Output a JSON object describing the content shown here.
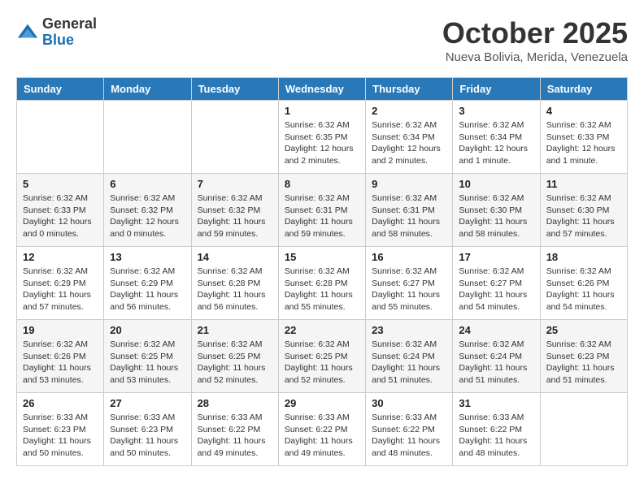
{
  "logo": {
    "general": "General",
    "blue": "Blue"
  },
  "title": "October 2025",
  "location": "Nueva Bolivia, Merida, Venezuela",
  "days_of_week": [
    "Sunday",
    "Monday",
    "Tuesday",
    "Wednesday",
    "Thursday",
    "Friday",
    "Saturday"
  ],
  "weeks": [
    [
      {
        "day": "",
        "info": ""
      },
      {
        "day": "",
        "info": ""
      },
      {
        "day": "",
        "info": ""
      },
      {
        "day": "1",
        "info": "Sunrise: 6:32 AM\nSunset: 6:35 PM\nDaylight: 12 hours and 2 minutes."
      },
      {
        "day": "2",
        "info": "Sunrise: 6:32 AM\nSunset: 6:34 PM\nDaylight: 12 hours and 2 minutes."
      },
      {
        "day": "3",
        "info": "Sunrise: 6:32 AM\nSunset: 6:34 PM\nDaylight: 12 hours and 1 minute."
      },
      {
        "day": "4",
        "info": "Sunrise: 6:32 AM\nSunset: 6:33 PM\nDaylight: 12 hours and 1 minute."
      }
    ],
    [
      {
        "day": "5",
        "info": "Sunrise: 6:32 AM\nSunset: 6:33 PM\nDaylight: 12 hours and 0 minutes."
      },
      {
        "day": "6",
        "info": "Sunrise: 6:32 AM\nSunset: 6:32 PM\nDaylight: 12 hours and 0 minutes."
      },
      {
        "day": "7",
        "info": "Sunrise: 6:32 AM\nSunset: 6:32 PM\nDaylight: 11 hours and 59 minutes."
      },
      {
        "day": "8",
        "info": "Sunrise: 6:32 AM\nSunset: 6:31 PM\nDaylight: 11 hours and 59 minutes."
      },
      {
        "day": "9",
        "info": "Sunrise: 6:32 AM\nSunset: 6:31 PM\nDaylight: 11 hours and 58 minutes."
      },
      {
        "day": "10",
        "info": "Sunrise: 6:32 AM\nSunset: 6:30 PM\nDaylight: 11 hours and 58 minutes."
      },
      {
        "day": "11",
        "info": "Sunrise: 6:32 AM\nSunset: 6:30 PM\nDaylight: 11 hours and 57 minutes."
      }
    ],
    [
      {
        "day": "12",
        "info": "Sunrise: 6:32 AM\nSunset: 6:29 PM\nDaylight: 11 hours and 57 minutes."
      },
      {
        "day": "13",
        "info": "Sunrise: 6:32 AM\nSunset: 6:29 PM\nDaylight: 11 hours and 56 minutes."
      },
      {
        "day": "14",
        "info": "Sunrise: 6:32 AM\nSunset: 6:28 PM\nDaylight: 11 hours and 56 minutes."
      },
      {
        "day": "15",
        "info": "Sunrise: 6:32 AM\nSunset: 6:28 PM\nDaylight: 11 hours and 55 minutes."
      },
      {
        "day": "16",
        "info": "Sunrise: 6:32 AM\nSunset: 6:27 PM\nDaylight: 11 hours and 55 minutes."
      },
      {
        "day": "17",
        "info": "Sunrise: 6:32 AM\nSunset: 6:27 PM\nDaylight: 11 hours and 54 minutes."
      },
      {
        "day": "18",
        "info": "Sunrise: 6:32 AM\nSunset: 6:26 PM\nDaylight: 11 hours and 54 minutes."
      }
    ],
    [
      {
        "day": "19",
        "info": "Sunrise: 6:32 AM\nSunset: 6:26 PM\nDaylight: 11 hours and 53 minutes."
      },
      {
        "day": "20",
        "info": "Sunrise: 6:32 AM\nSunset: 6:25 PM\nDaylight: 11 hours and 53 minutes."
      },
      {
        "day": "21",
        "info": "Sunrise: 6:32 AM\nSunset: 6:25 PM\nDaylight: 11 hours and 52 minutes."
      },
      {
        "day": "22",
        "info": "Sunrise: 6:32 AM\nSunset: 6:25 PM\nDaylight: 11 hours and 52 minutes."
      },
      {
        "day": "23",
        "info": "Sunrise: 6:32 AM\nSunset: 6:24 PM\nDaylight: 11 hours and 51 minutes."
      },
      {
        "day": "24",
        "info": "Sunrise: 6:32 AM\nSunset: 6:24 PM\nDaylight: 11 hours and 51 minutes."
      },
      {
        "day": "25",
        "info": "Sunrise: 6:32 AM\nSunset: 6:23 PM\nDaylight: 11 hours and 51 minutes."
      }
    ],
    [
      {
        "day": "26",
        "info": "Sunrise: 6:33 AM\nSunset: 6:23 PM\nDaylight: 11 hours and 50 minutes."
      },
      {
        "day": "27",
        "info": "Sunrise: 6:33 AM\nSunset: 6:23 PM\nDaylight: 11 hours and 50 minutes."
      },
      {
        "day": "28",
        "info": "Sunrise: 6:33 AM\nSunset: 6:22 PM\nDaylight: 11 hours and 49 minutes."
      },
      {
        "day": "29",
        "info": "Sunrise: 6:33 AM\nSunset: 6:22 PM\nDaylight: 11 hours and 49 minutes."
      },
      {
        "day": "30",
        "info": "Sunrise: 6:33 AM\nSunset: 6:22 PM\nDaylight: 11 hours and 48 minutes."
      },
      {
        "day": "31",
        "info": "Sunrise: 6:33 AM\nSunset: 6:22 PM\nDaylight: 11 hours and 48 minutes."
      },
      {
        "day": "",
        "info": ""
      }
    ]
  ]
}
